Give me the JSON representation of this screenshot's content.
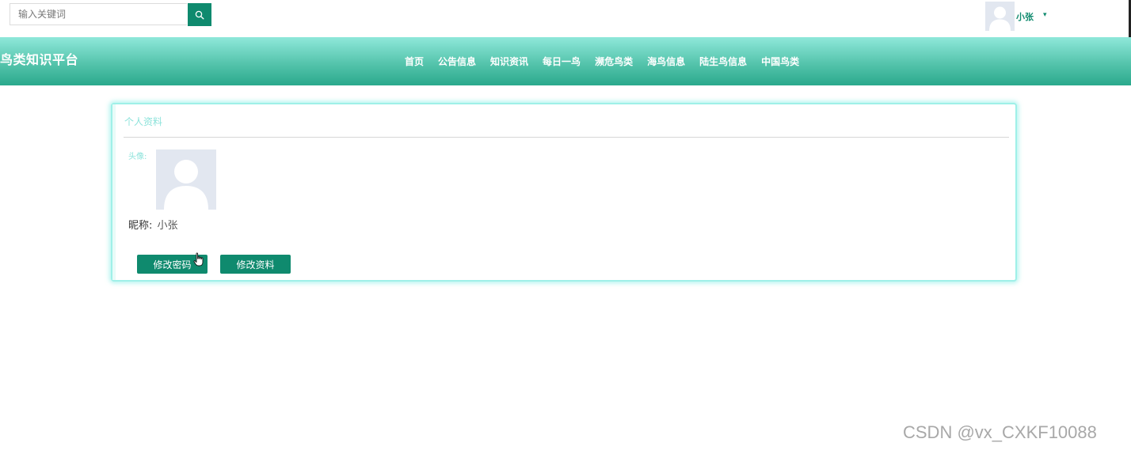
{
  "search": {
    "placeholder": "输入关键词",
    "button_icon": "search-icon"
  },
  "user": {
    "name": "小张",
    "avatar_icon": "person-silhouette-icon",
    "caret_icon": "caret-down-icon"
  },
  "brand": {
    "title": "鸟类知识平台"
  },
  "nav": {
    "items": [
      {
        "label": "首页"
      },
      {
        "label": "公告信息"
      },
      {
        "label": "知识资讯"
      },
      {
        "label": "每日一鸟"
      },
      {
        "label": "濒危鸟类"
      },
      {
        "label": "海鸟信息"
      },
      {
        "label": "陆生鸟信息"
      },
      {
        "label": "中国鸟类"
      }
    ]
  },
  "profile": {
    "title": "个人资料",
    "avatar_label": "头像:",
    "nickname_label": "昵称:",
    "nickname_value": "小张",
    "change_password_label": "修改密码",
    "edit_profile_label": "修改资料"
  },
  "watermark": {
    "text": "CSDN @vx_CXKF10088"
  },
  "colors": {
    "accent": "#0f8a6e",
    "nav_gradient_top": "#8fe8da",
    "nav_gradient_bottom": "#2aa98c",
    "card_border": "#9ff0e8",
    "avatar_bg": "#e2e7f0"
  }
}
